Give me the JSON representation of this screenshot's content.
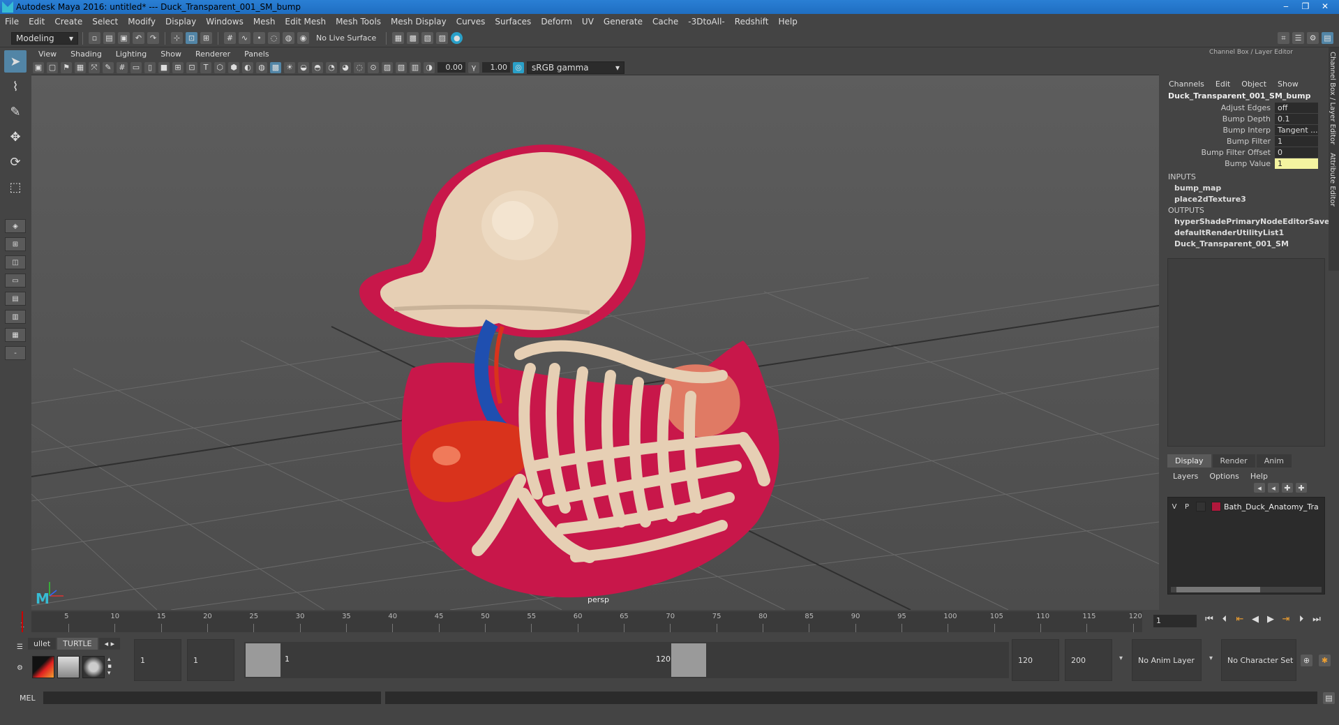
{
  "window": {
    "title": "Autodesk Maya 2016: untitled*   ---   Duck_Transparent_001_SM_bump"
  },
  "menus": [
    "File",
    "Edit",
    "Create",
    "Select",
    "Modify",
    "Display",
    "Windows",
    "Mesh",
    "Edit Mesh",
    "Mesh Tools",
    "Mesh Display",
    "Curves",
    "Surfaces",
    "Deform",
    "UV",
    "Generate",
    "Cache",
    "-3DtoAll-",
    "Redshift",
    "Help"
  ],
  "toolbar": {
    "mode": "Modeling",
    "live_surface": "No Live Surface"
  },
  "viewport": {
    "menus": [
      "View",
      "Shading",
      "Lighting",
      "Show",
      "Renderer",
      "Panels"
    ],
    "exposure": "0.00",
    "gamma": "1.00",
    "colorspace": "sRGB gamma",
    "camera": "persp"
  },
  "channel_box": {
    "title": "Channel Box / Layer Editor",
    "menus": [
      "Channels",
      "Edit",
      "Object",
      "Show"
    ],
    "node": "Duck_Transparent_001_SM_bump",
    "attributes": [
      {
        "name": "Adjust Edges",
        "value": "off"
      },
      {
        "name": "Bump Depth",
        "value": "0.1"
      },
      {
        "name": "Bump Interp",
        "value": "Tangent ..."
      },
      {
        "name": "Bump Filter",
        "value": "1"
      },
      {
        "name": "Bump Filter Offset",
        "value": "0"
      },
      {
        "name": "Bump Value",
        "value": "1"
      }
    ],
    "inputs_label": "INPUTS",
    "inputs": [
      "bump_map",
      "place2dTexture3"
    ],
    "outputs_label": "OUTPUTS",
    "outputs": [
      "hyperShadePrimaryNodeEditorSavedT...",
      "defaultRenderUtilityList1",
      "Duck_Transparent_001_SM"
    ]
  },
  "side_tabs": [
    "Channel Box / Layer Editor",
    "Attribute Editor"
  ],
  "layer_editor": {
    "tabs": [
      "Display",
      "Render",
      "Anim"
    ],
    "menus": [
      "Layers",
      "Options",
      "Help"
    ],
    "layer": {
      "v": "V",
      "p": "P",
      "name": "Bath_Duck_Anatomy_Tra",
      "color": "#b0183c"
    }
  },
  "timeline": {
    "ticks": [
      "5",
      "10",
      "15",
      "20",
      "25",
      "30",
      "35",
      "40",
      "45",
      "50",
      "55",
      "60",
      "65",
      "70",
      "75",
      "80",
      "85",
      "90",
      "95",
      "100",
      "105",
      "110",
      "115",
      "120"
    ],
    "start_frame": "1",
    "current_frame": "1"
  },
  "range": {
    "shelf_tabs": [
      "ullet",
      "TURTLE"
    ],
    "start": "1",
    "playback_start": "1",
    "range_start_label": "1",
    "range_end_label": "120",
    "playback_end": "120",
    "end": "200",
    "anim_layer": "No Anim Layer",
    "character_set": "No Character Set"
  },
  "cmdline": {
    "label": "MEL"
  },
  "colors": {
    "duck_shell": "#c8174a",
    "bone": "#e6cfb4",
    "organ": "#d9331c",
    "trachea": "#1f4fb0"
  }
}
